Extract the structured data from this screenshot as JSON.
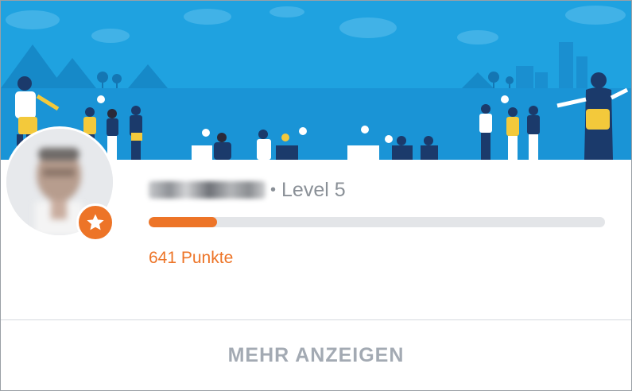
{
  "profile": {
    "level_label": "Level 5",
    "separator": "•",
    "points_label": "641 Punkte",
    "progress_fraction": 0.15
  },
  "actions": {
    "more_label": "MEHR ANZEIGEN"
  },
  "colors": {
    "accent_orange": "#ed7427",
    "banner_blue": "#1fa2e0",
    "muted_text": "#8a9097",
    "progress_track": "#e3e5e8",
    "button_text": "#a3aab3"
  },
  "icons": {
    "badge": "star-icon",
    "banner": "community-illustration"
  }
}
